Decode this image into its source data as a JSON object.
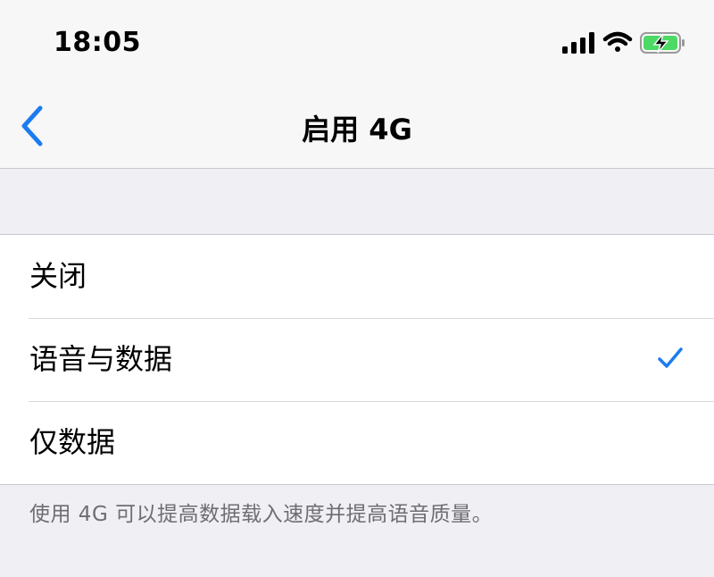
{
  "status_bar": {
    "time": "18:05",
    "icons": [
      "cellular-signal-icon",
      "wifi-icon",
      "battery-charging-icon"
    ]
  },
  "nav": {
    "back_icon": "chevron-left-icon",
    "title": "启用 4G"
  },
  "options": [
    {
      "label": "关闭",
      "selected": false
    },
    {
      "label": "语音与数据",
      "selected": true
    },
    {
      "label": "仅数据",
      "selected": false
    }
  ],
  "footer": {
    "note": "使用 4G 可以提高数据载入速度并提高语音质量。"
  },
  "colors": {
    "accent": "#1a7cf0",
    "battery": "#4cd964"
  }
}
